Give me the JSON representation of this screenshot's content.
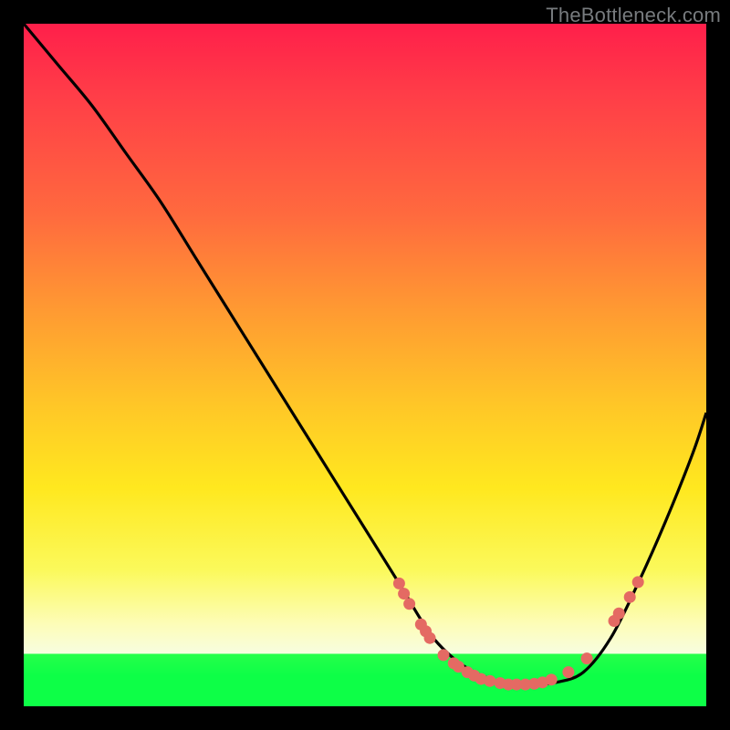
{
  "watermark": "TheBottleneck.com",
  "colors": {
    "frame": "#000000",
    "curve": "#000000",
    "marker": "#e46a63",
    "grad_top": "#ff1f4a",
    "grad_mid": "#ffe81f",
    "grad_bottom": "#0dff47"
  },
  "chart_data": {
    "type": "line",
    "title": "",
    "xlabel": "",
    "ylabel": "",
    "xlim": [
      0,
      100
    ],
    "ylim": [
      0,
      100
    ],
    "x": [
      0,
      5,
      10,
      15,
      20,
      25,
      30,
      35,
      40,
      45,
      50,
      55,
      58,
      60,
      63,
      66,
      70,
      74,
      78,
      82,
      86,
      90,
      94,
      98,
      100
    ],
    "values": [
      100,
      94,
      88,
      81,
      74,
      66,
      58,
      50,
      42,
      34,
      26,
      18,
      13,
      10,
      7,
      5,
      3.5,
      3.2,
      3.5,
      5,
      10,
      18,
      27,
      37,
      43
    ],
    "markers": [
      {
        "x": 55.0,
        "y": 18.0
      },
      {
        "x": 55.7,
        "y": 16.5
      },
      {
        "x": 56.5,
        "y": 15.0
      },
      {
        "x": 58.2,
        "y": 12.0
      },
      {
        "x": 58.9,
        "y": 11.0
      },
      {
        "x": 59.5,
        "y": 10.0
      },
      {
        "x": 61.5,
        "y": 7.5
      },
      {
        "x": 63.0,
        "y": 6.3
      },
      {
        "x": 63.7,
        "y": 5.8
      },
      {
        "x": 65.0,
        "y": 5.0
      },
      {
        "x": 66.0,
        "y": 4.5
      },
      {
        "x": 67.0,
        "y": 4.0
      },
      {
        "x": 68.3,
        "y": 3.7
      },
      {
        "x": 69.8,
        "y": 3.4
      },
      {
        "x": 71.0,
        "y": 3.2
      },
      {
        "x": 72.2,
        "y": 3.2
      },
      {
        "x": 73.5,
        "y": 3.2
      },
      {
        "x": 74.8,
        "y": 3.3
      },
      {
        "x": 76.0,
        "y": 3.5
      },
      {
        "x": 77.3,
        "y": 3.9
      },
      {
        "x": 79.8,
        "y": 5.0
      },
      {
        "x": 82.5,
        "y": 7.0
      },
      {
        "x": 86.5,
        "y": 12.5
      },
      {
        "x": 87.2,
        "y": 13.6
      },
      {
        "x": 88.8,
        "y": 16.0
      },
      {
        "x": 90.0,
        "y": 18.2
      }
    ]
  }
}
